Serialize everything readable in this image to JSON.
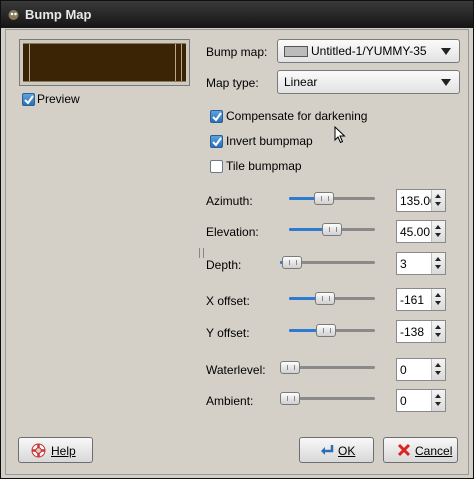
{
  "window": {
    "title": "Bump Map"
  },
  "preview": {
    "label": "Preview",
    "checked": true
  },
  "bump_map": {
    "label": "Bump map:",
    "value": "Untitled-1/YUMMY-35"
  },
  "map_type": {
    "label": "Map type:",
    "value": "Linear"
  },
  "options": {
    "compensate": {
      "label": "Compensate for darkening",
      "checked": true
    },
    "invert": {
      "label": "Invert bumpmap",
      "checked": true
    },
    "tile": {
      "label": "Tile bumpmap",
      "checked": false
    }
  },
  "sliders": {
    "azimuth": {
      "label": "Azimuth:",
      "value": "135.00",
      "fraction": 0.375
    },
    "elevation": {
      "label": "Elevation:",
      "value": "45.00",
      "fraction": 0.5
    },
    "depth": {
      "label": "Depth:",
      "value": "3",
      "fraction": 0.03
    },
    "x_offset": {
      "label": "X offset:",
      "value": "-161",
      "fraction": 0.4
    },
    "y_offset": {
      "label": "Y offset:",
      "value": "-138",
      "fraction": 0.41
    },
    "waterlevel": {
      "label": "Waterlevel:",
      "value": "0",
      "fraction": 0.0
    },
    "ambient": {
      "label": "Ambient:",
      "value": "0",
      "fraction": 0.0
    }
  },
  "buttons": {
    "help": "Help",
    "ok": "OK",
    "cancel": "Cancel"
  },
  "colors": {
    "accent": "#2b7bd0",
    "titlebar": "#1e1e1e",
    "dialog_bg": "#d4d0c8"
  }
}
